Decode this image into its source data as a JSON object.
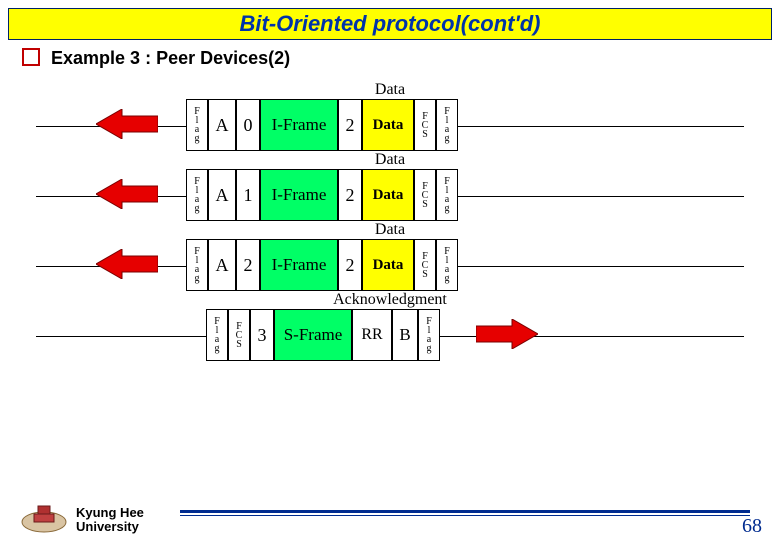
{
  "title": "Bit-Oriented protocol(cont'd)",
  "subhead": "Example 3 : Peer Devices(2)",
  "labels": {
    "flag": "F\nl\na\ng",
    "fcs": "F\nC\nS",
    "A": "A",
    "B": "B",
    "iframe": "I-Frame",
    "sframe": "S-Frame",
    "data_field": "Data",
    "rr": "RR"
  },
  "captions": {
    "data": "Data",
    "ack": "Acknowledgment"
  },
  "rows": [
    {
      "type": "data",
      "dir": "left",
      "ns": "0",
      "nr": "2"
    },
    {
      "type": "data",
      "dir": "left",
      "ns": "1",
      "nr": "2"
    },
    {
      "type": "data",
      "dir": "left",
      "ns": "2",
      "nr": "2"
    },
    {
      "type": "ack",
      "dir": "right",
      "nr": "3"
    }
  ],
  "footer": {
    "univ_line1": "Kyung Hee",
    "univ_line2": "University",
    "page": "68"
  },
  "colors": {
    "accent": "#002b8f",
    "bullet": "#c00000"
  }
}
